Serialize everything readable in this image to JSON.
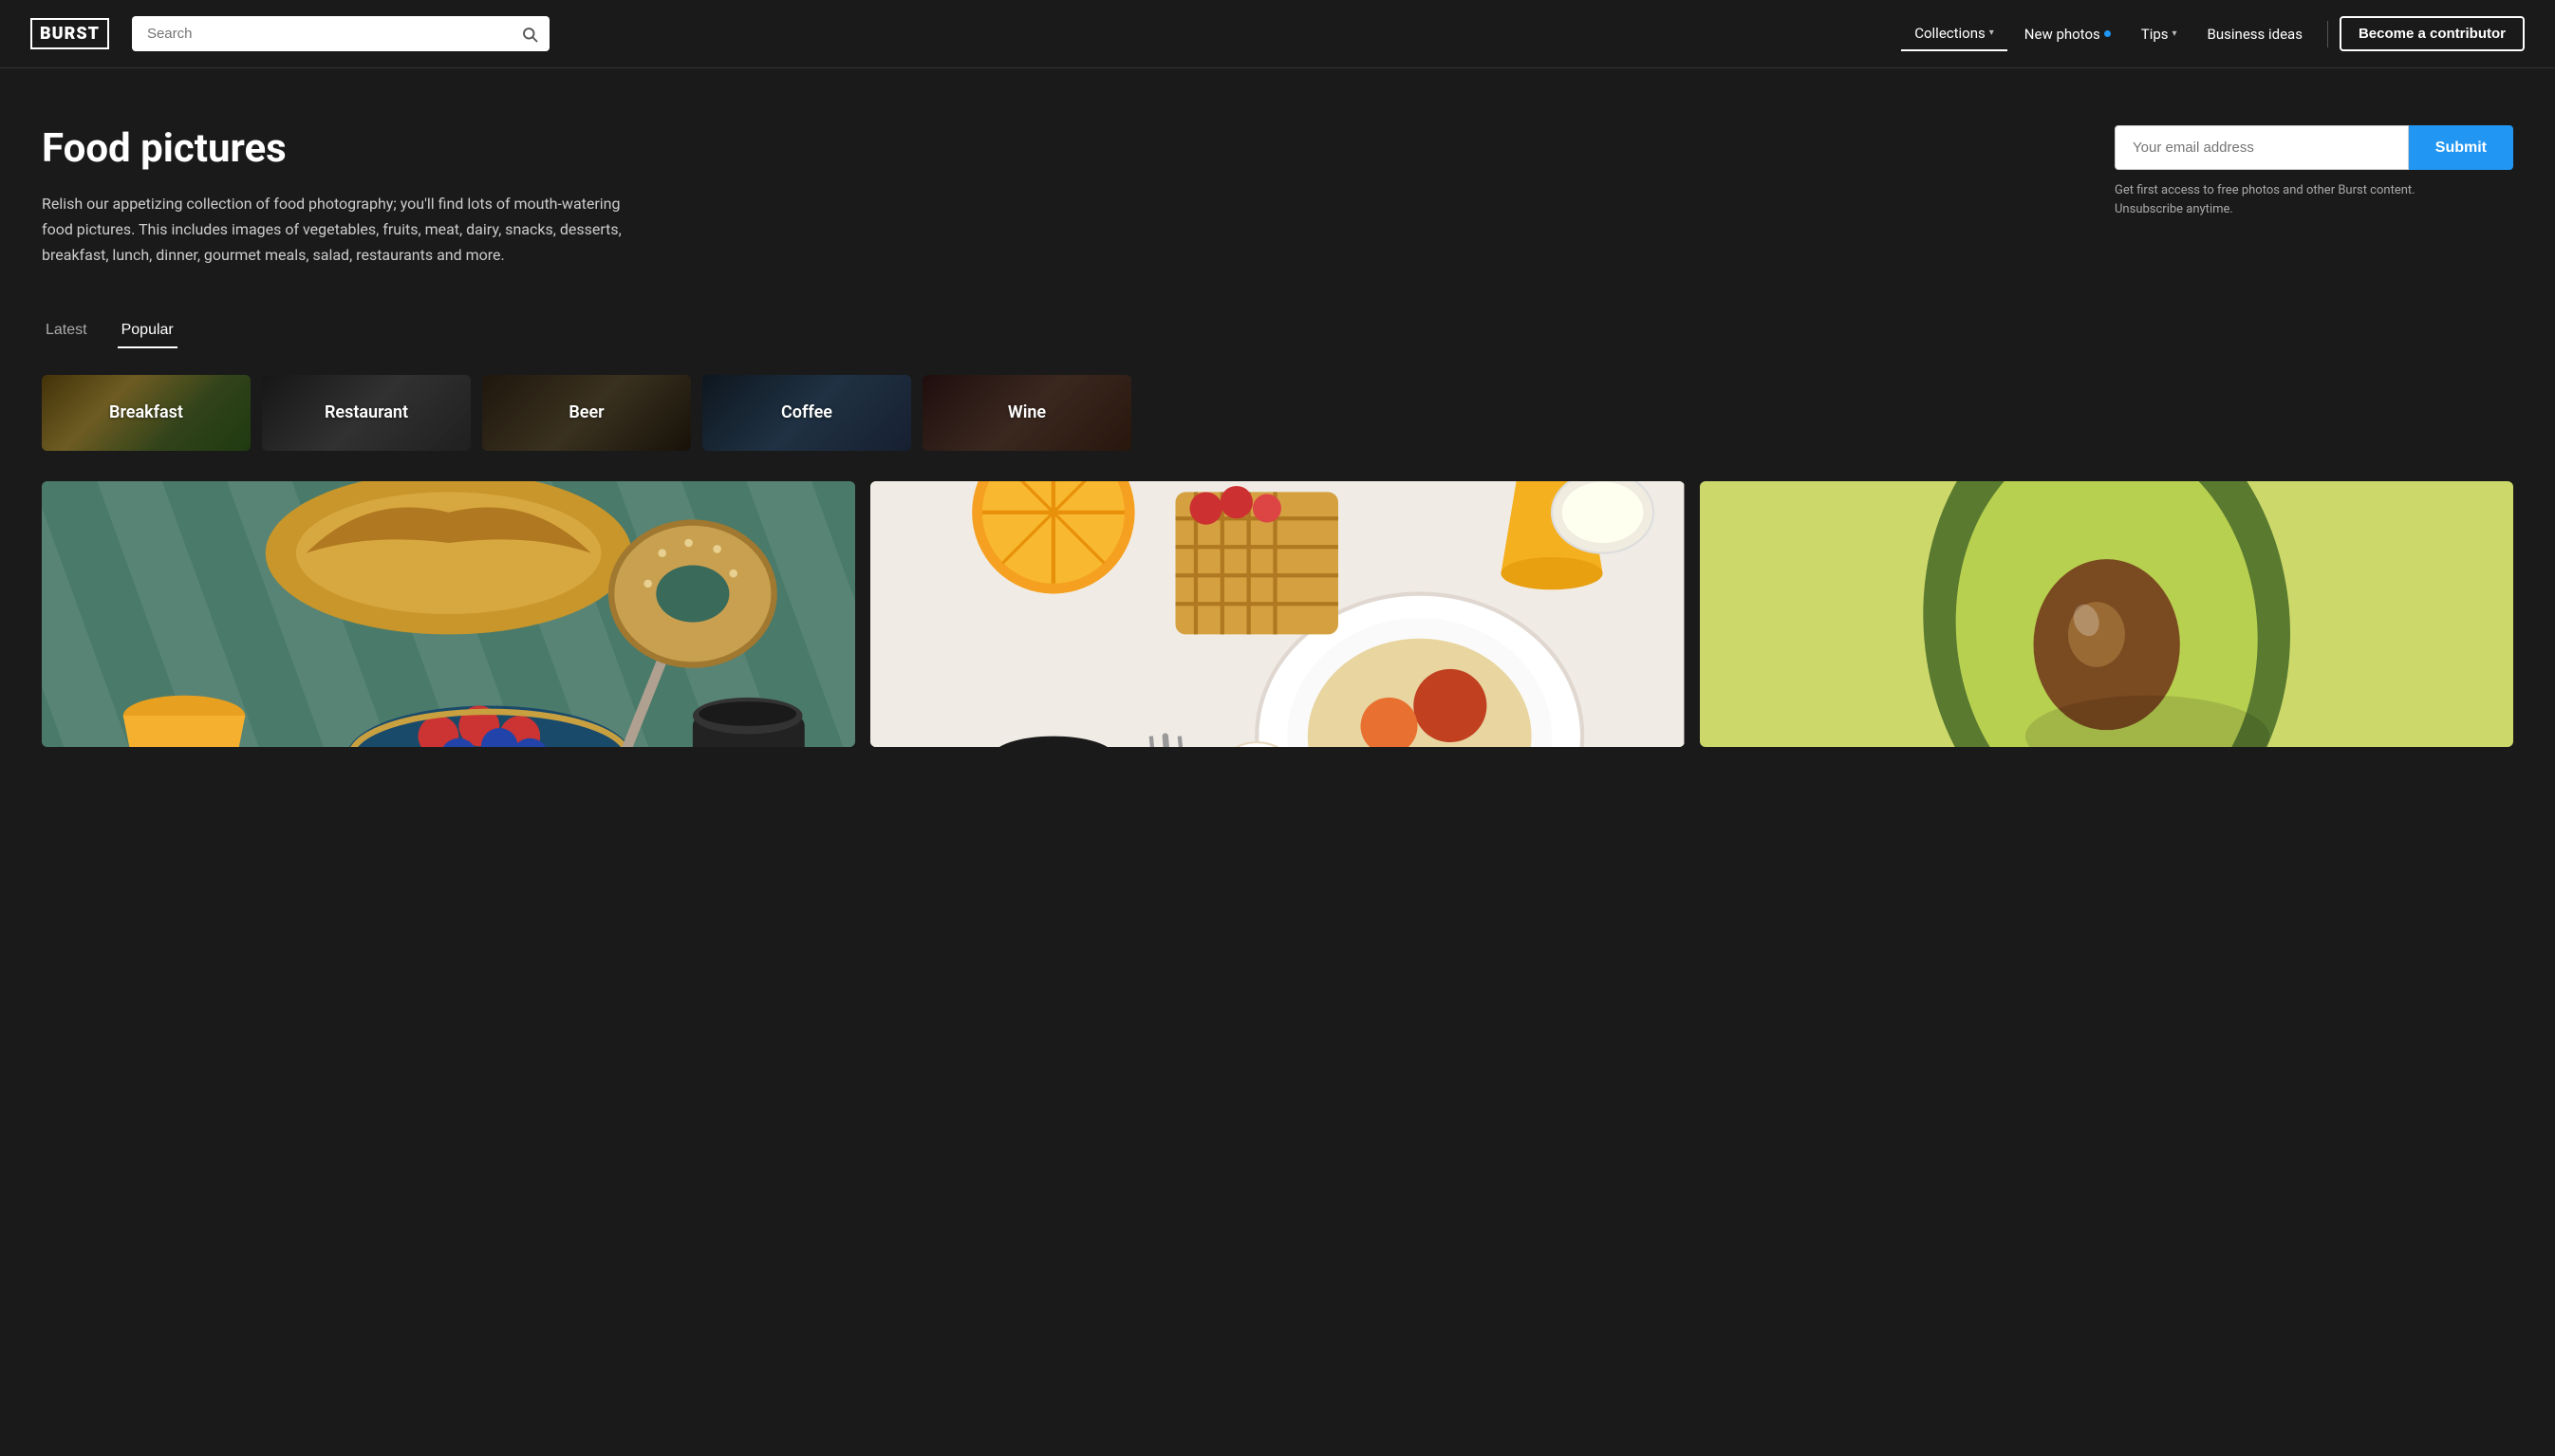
{
  "header": {
    "logo": "BURST",
    "search": {
      "placeholder": "Search"
    },
    "nav": [
      {
        "id": "collections",
        "label": "Collections",
        "active": true,
        "has_caret": true
      },
      {
        "id": "new-photos",
        "label": "New photos",
        "active": false,
        "has_dot": true
      },
      {
        "id": "tips",
        "label": "Tips",
        "active": false,
        "has_caret": true
      },
      {
        "id": "business-ideas",
        "label": "Business ideas",
        "active": false
      }
    ],
    "cta": "Become a contributor"
  },
  "hero": {
    "title": "Food pictures",
    "description": "Relish our appetizing collection of food photography; you'll find lots of mouth-watering food pictures. This includes images of vegetables, fruits, meat, dairy, snacks, desserts, breakfast, lunch, dinner, gourmet meals, salad, restaurants and more.",
    "email_form": {
      "placeholder": "Your email address",
      "submit_label": "Submit",
      "note": "Get first access to free photos and other Burst content.\nUnsubscribe anytime."
    }
  },
  "tabs": [
    {
      "id": "latest",
      "label": "Latest",
      "active": false
    },
    {
      "id": "popular",
      "label": "Popular",
      "active": true
    }
  ],
  "categories": [
    {
      "id": "breakfast",
      "label": "Breakfast"
    },
    {
      "id": "restaurant",
      "label": "Restaurant"
    },
    {
      "id": "beer",
      "label": "Beer"
    },
    {
      "id": "coffee",
      "label": "Coffee"
    },
    {
      "id": "wine",
      "label": "Wine"
    }
  ],
  "photos": [
    {
      "id": "photo-1",
      "alt": "Breakfast spread with croissant and berries",
      "type": "breakfast"
    },
    {
      "id": "photo-2",
      "alt": "Full breakfast spread from above",
      "type": "spread"
    },
    {
      "id": "photo-3",
      "alt": "Avocado half on green background",
      "type": "avocado"
    }
  ]
}
